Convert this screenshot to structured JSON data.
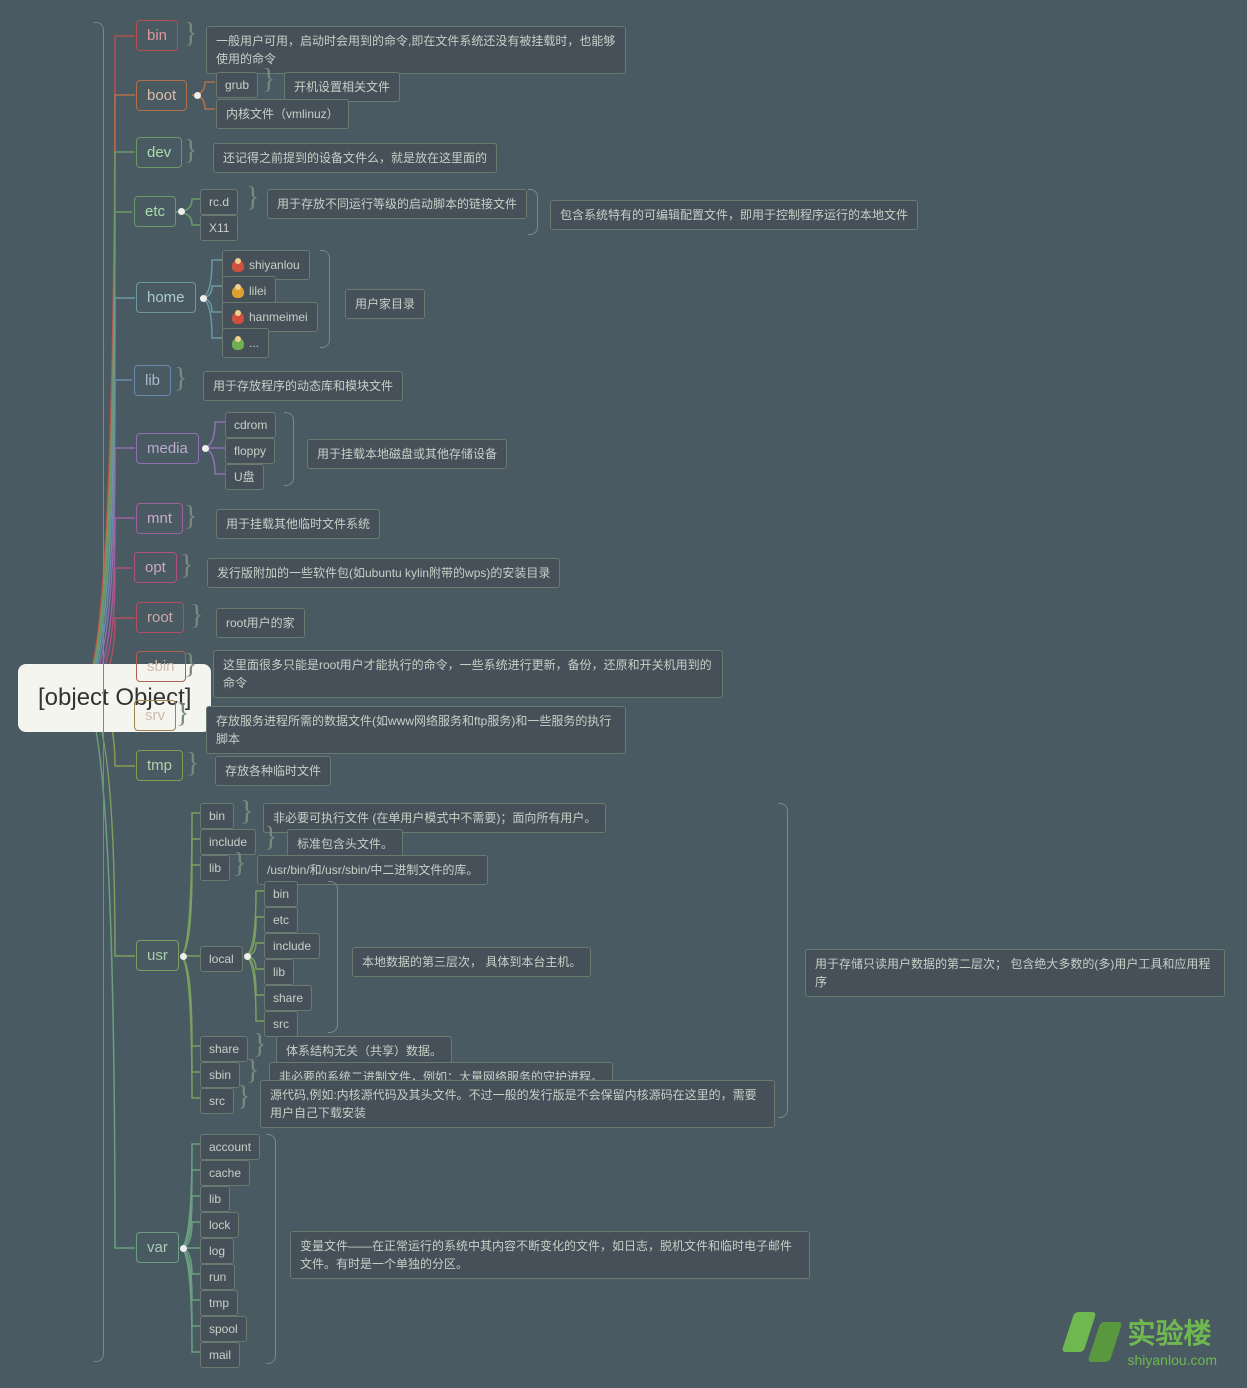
{
  "root": {
    "label": "root",
    "note": "root用户的家",
    "color": "#b05060"
  },
  "bin": {
    "label": "bin",
    "note": "一般用户可用，启动时会用到的命令,即在文件系统还没有被挂载时，也能够使用的命令",
    "color": "#b05050"
  },
  "boot": {
    "label": "boot",
    "color": "#b0704a",
    "grub": {
      "label": "grub",
      "note": "开机设置相关文件"
    },
    "vmlinuz": "内核文件（vmlinuz）"
  },
  "dev": {
    "label": "dev",
    "note": "还记得之前提到的设备文件么，就是放在这里面的",
    "color": "#6a9a6a"
  },
  "etc": {
    "label": "etc",
    "color": "#6a9a6a",
    "rcd": {
      "label": "rc.d",
      "note": "用于存放不同运行等级的启动脚本的链接文件"
    },
    "x11": "X11",
    "note": "包含系统特有的可编辑配置文件，即用于控制程序运行的本地文件"
  },
  "home": {
    "label": "home",
    "color": "#6a9aa0",
    "u1": "shiyanlou",
    "u2": "lilei",
    "u3": "hanmeimei",
    "u4": "...",
    "note": "用户家目录"
  },
  "lib": {
    "label": "lib",
    "note": "用于存放程序的动态库和模块文件",
    "color": "#6a8ab0"
  },
  "media": {
    "label": "media",
    "color": "#9070b0",
    "cdrom": "cdrom",
    "floppy": "floppy",
    "udisk": "U盘",
    "note": "用于挂载本地磁盘或其他存储设备"
  },
  "mnt": {
    "label": "mnt",
    "note": "用于挂载其他临时文件系统",
    "color": "#a060a0"
  },
  "opt": {
    "label": "opt",
    "note": "发行版附加的一些软件包(如ubuntu kylin附带的wps)的安装目录",
    "color": "#b05080"
  },
  "sbin": {
    "label": "sbin",
    "note": "这里面很多只能是root用户才能执行的命令，一些系统进行更新，备份，还原和开关机用到的命令",
    "color": "#b06050"
  },
  "srv": {
    "label": "srv",
    "note": "存放服务进程所需的数据文件(如www网络服务和ftp服务)和一些服务的执行脚本",
    "color": "#a08050"
  },
  "tmp": {
    "label": "tmp",
    "note": "存放各种临时文件",
    "color": "#8a9a50"
  },
  "usr": {
    "label": "usr",
    "color": "#7aa060",
    "note": "用于存储只读用户数据的第二层次； 包含绝大多数的(多)用户工具和应用程序",
    "bin": {
      "label": "bin",
      "note": "非必要可执行文件 (在单用户模式中不需要)；面向所有用户。"
    },
    "include": {
      "label": "include",
      "note": "标准包含头文件。"
    },
    "lib": {
      "label": "lib",
      "note": "/usr/bin/和/usr/sbin/中二进制文件的库。"
    },
    "local": {
      "label": "local",
      "note": "本地数据的第三层次， 具体到本台主机。",
      "bin": "bin",
      "etc": "etc",
      "include": "include",
      "lib2": "lib",
      "share": "share",
      "src": "src"
    },
    "share": {
      "label": "share",
      "note": "体系结构无关（共享）数据。"
    },
    "sbin": {
      "label": "sbin",
      "note": "非必要的系统二进制文件，例如：大量网络服务的守护进程。"
    },
    "src": {
      "label": "src",
      "note": "源代码,例如:内核源代码及其头文件。不过一般的发行版是不会保留内核源码在这里的，需要用户自己下载安装"
    }
  },
  "var": {
    "label": "var",
    "color": "#6aa080",
    "note": "变量文件——在正常运行的系统中其内容不断变化的文件，如日志，脱机文件和临时电子邮件文件。有时是一个单独的分区。",
    "account": "account",
    "cache": "cache",
    "lib": "lib",
    "lock": "lock",
    "log": "log",
    "run": "run",
    "tmp": "tmp",
    "spool": "spool",
    "mail": "mail"
  },
  "watermark": {
    "title": "实验楼",
    "sub": "shiyanlou.com"
  }
}
